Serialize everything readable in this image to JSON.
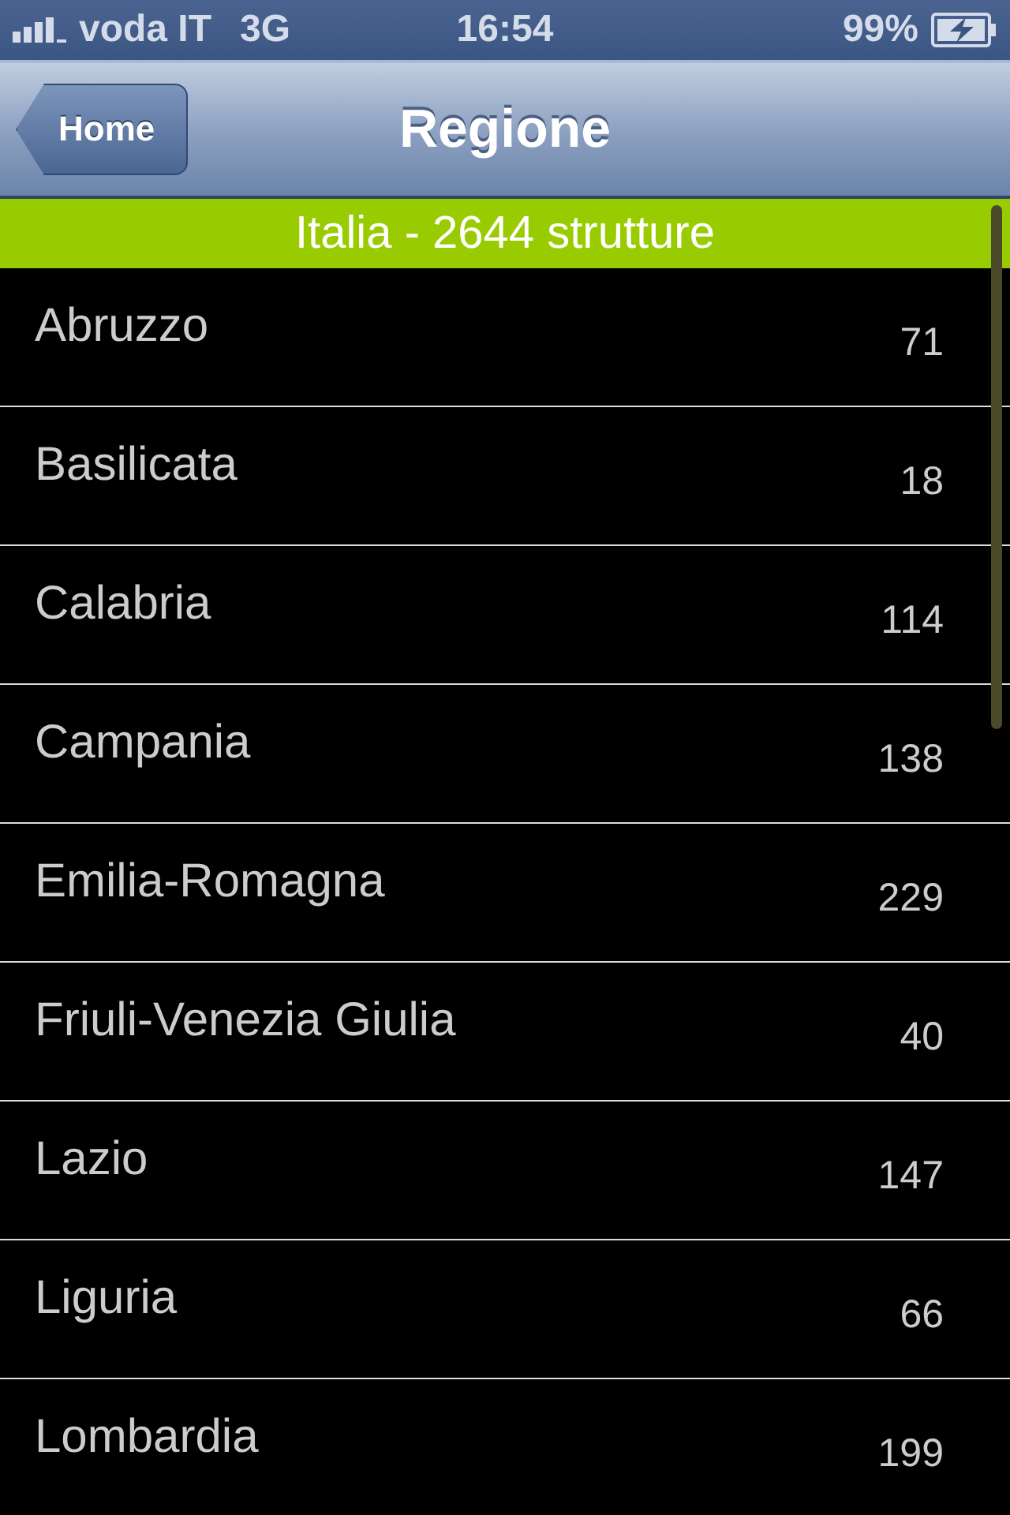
{
  "status_bar": {
    "carrier": "voda IT",
    "network": "3G",
    "time": "16:54",
    "battery": "99%"
  },
  "nav_bar": {
    "back_button": "Home",
    "title": "Regione"
  },
  "section_header": "Italia - 2644 strutture",
  "regions": [
    {
      "name": "Abruzzo",
      "count": "71"
    },
    {
      "name": "Basilicata",
      "count": "18"
    },
    {
      "name": "Calabria",
      "count": "114"
    },
    {
      "name": "Campania",
      "count": "138"
    },
    {
      "name": "Emilia-Romagna",
      "count": "229"
    },
    {
      "name": "Friuli-Venezia Giulia",
      "count": "40"
    },
    {
      "name": "Lazio",
      "count": "147"
    },
    {
      "name": "Liguria",
      "count": "66"
    },
    {
      "name": "Lombardia",
      "count": "199"
    }
  ]
}
